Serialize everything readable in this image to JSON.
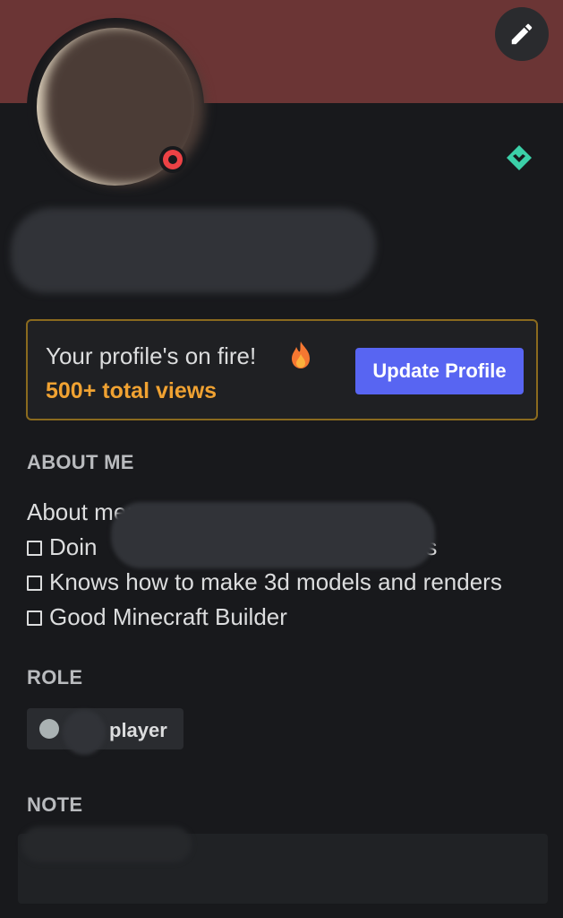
{
  "colors": {
    "banner": "#6b3535",
    "background": "#18191c",
    "accent": "#5865f2",
    "fire_text": "#f0a232",
    "status_dnd": "#ed4245",
    "nitro_badge": "#3bd0a8"
  },
  "icons": {
    "edit": "pencil-icon",
    "status": "do-not-disturb-status-icon",
    "badge": "nitro-boost-badge-icon",
    "fire": "fire-icon"
  },
  "promo": {
    "title": "Your profile's on fire!",
    "views": "500+ total views",
    "button_label": "Update Profile"
  },
  "about": {
    "heading": "ABOUT ME",
    "lines": [
      {
        "checkbox": false,
        "text": "About me:"
      },
      {
        "checkbox": true,
        "text": "Doin"
      },
      {
        "checkbox": true,
        "text": "Knows how to make 3d models and renders"
      },
      {
        "checkbox": true,
        "text": "Good Minecraft Builder"
      }
    ],
    "line2_tail": "ons"
  },
  "role": {
    "heading": "ROLE",
    "name": "player",
    "color": "#aab2b3"
  },
  "note": {
    "heading": "NOTE"
  }
}
